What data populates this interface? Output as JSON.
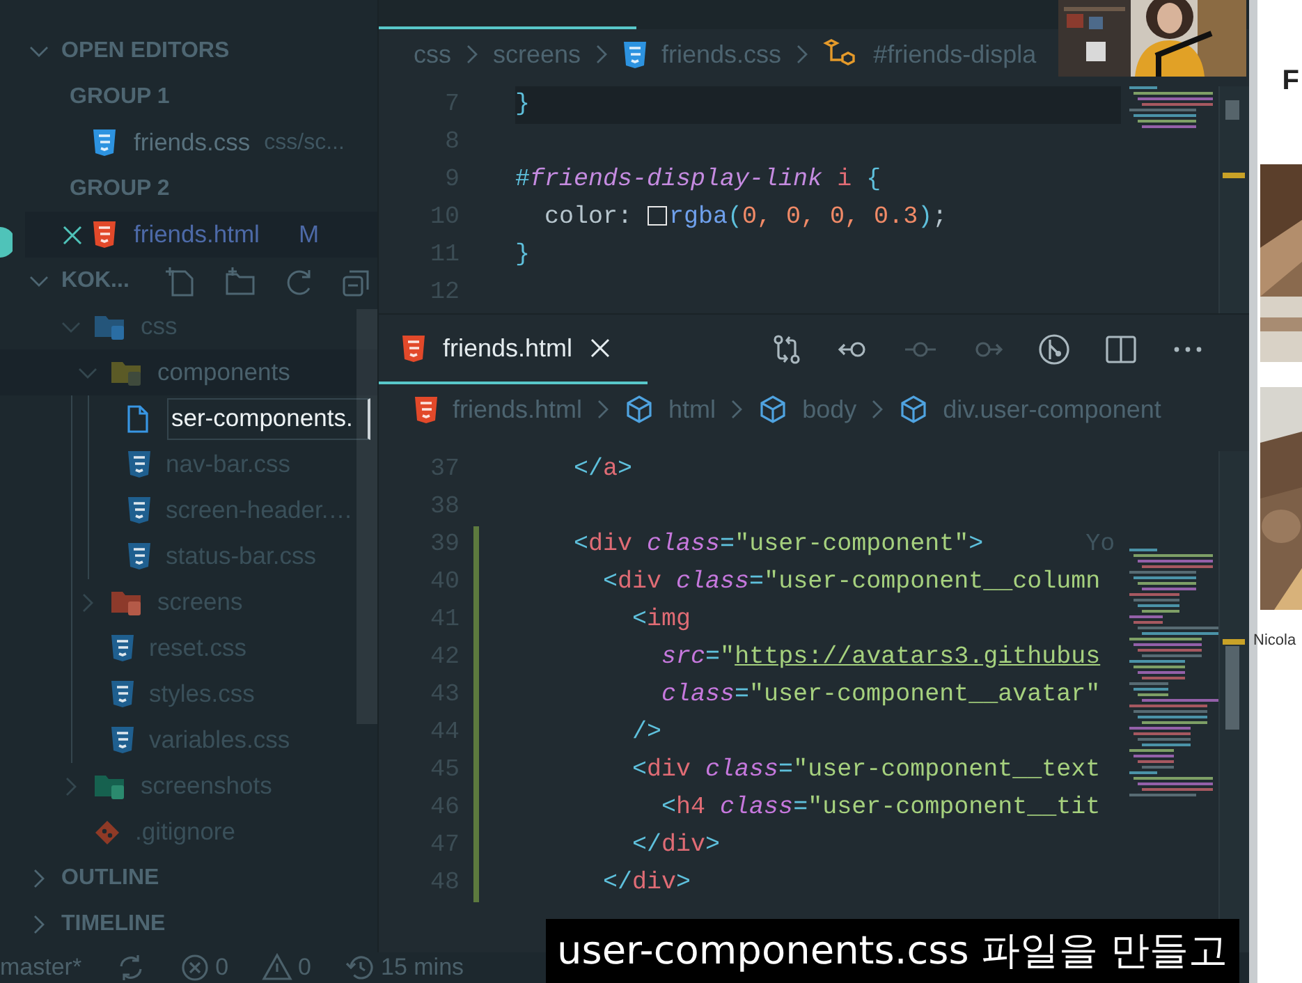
{
  "sidebar": {
    "open_editors": {
      "title": "OPEN EDITORS",
      "expanded": true,
      "groups": [
        {
          "title": "GROUP 1",
          "files": [
            {
              "name": "friends.css",
              "kind": "css",
              "path": "css/sc...",
              "selected": false
            }
          ]
        },
        {
          "title": "GROUP 2",
          "files": [
            {
              "name": "friends.html",
              "kind": "html",
              "badge": "M",
              "selected": true
            }
          ]
        }
      ]
    },
    "folder": {
      "title": "KOK...",
      "expanded": true,
      "actions": [
        {
          "kind": "new-file"
        },
        {
          "kind": "new-folder"
        },
        {
          "kind": "refresh"
        },
        {
          "kind": "collapse"
        }
      ],
      "tree": [
        {
          "name": "css",
          "kind": "folder-css",
          "expanded": true,
          "selected": false,
          "children": [
            {
              "name": "components",
              "kind": "folder-components",
              "expanded": true,
              "selected": true,
              "children": [
                {
                  "kind": "rename",
                  "value": "ser-components."
                },
                {
                  "name": "nav-bar.css",
                  "kind": "css",
                  "selected": false
                },
                {
                  "name": "screen-header.…",
                  "kind": "css",
                  "selected": false
                },
                {
                  "name": "status-bar.css",
                  "kind": "css",
                  "selected": false
                }
              ]
            },
            {
              "name": "screens",
              "kind": "folder-screens",
              "expanded": false,
              "selected": false
            },
            {
              "name": "reset.css",
              "kind": "css",
              "selected": false
            },
            {
              "name": "styles.css",
              "kind": "css",
              "selected": false
            },
            {
              "name": "variables.css",
              "kind": "css",
              "selected": false
            }
          ]
        },
        {
          "name": "screenshots",
          "kind": "folder-images",
          "expanded": false,
          "selected": false
        },
        {
          "name": ".gitignore",
          "kind": "git",
          "selected": false
        }
      ]
    },
    "sections": [
      {
        "title": "OUTLINE",
        "expanded": false
      },
      {
        "title": "TIMELINE",
        "expanded": false
      }
    ]
  },
  "editors": [
    {
      "tab": {
        "selected": true
      },
      "breadcrumb": [
        {
          "text": "css",
          "kind": "plain"
        },
        {
          "text": "screens",
          "kind": "plain"
        },
        {
          "text": "friends.css",
          "kind": "css"
        },
        {
          "text": "#friends-displa",
          "kind": "symbol"
        }
      ],
      "lines": [
        {
          "number": "7",
          "current": true,
          "tokens": [
            {
              "text": "}",
              "kind": "p"
            }
          ]
        },
        {
          "number": "8",
          "current": false
        },
        {
          "number": "9",
          "current": false,
          "tokens": [
            {
              "text": "#",
              "kind": "p"
            },
            {
              "text": "friends-display-link",
              "kind": "sel"
            },
            {
              "text": " i",
              "kind": "tag"
            },
            {
              "text": " {",
              "kind": "p"
            }
          ]
        },
        {
          "number": "10",
          "current": false,
          "tokens": [
            {
              "text": "  color: ",
              "kind": "prop"
            },
            {
              "kind": "swatch"
            },
            {
              "text": "rgba",
              "kind": "fn"
            },
            {
              "text": "(",
              "kind": "p"
            },
            {
              "text": "0, 0, 0, 0.3",
              "kind": "num"
            },
            {
              "text": ")",
              "kind": "p"
            },
            {
              "text": ";",
              "kind": "prop"
            }
          ]
        },
        {
          "number": "11",
          "current": false,
          "tokens": [
            {
              "text": "}",
              "kind": "p"
            }
          ]
        },
        {
          "number": "12",
          "current": false
        }
      ]
    },
    {
      "tab": {
        "label": "friends.html",
        "kind": "html",
        "selected": true
      },
      "toolbar": [
        {
          "kind": "compare",
          "disabled": false
        },
        {
          "kind": "back",
          "disabled": false
        },
        {
          "kind": "commit",
          "disabled": true
        },
        {
          "kind": "forward",
          "disabled": true
        },
        {
          "kind": "graph",
          "disabled": false
        },
        {
          "kind": "split",
          "disabled": false
        },
        {
          "kind": "more",
          "disabled": false
        }
      ],
      "breadcrumb": [
        {
          "text": "friends.html",
          "kind": "html"
        },
        {
          "text": "html",
          "kind": "cube"
        },
        {
          "text": "body",
          "kind": "cube"
        },
        {
          "text": "div.user-component",
          "kind": "cube"
        }
      ],
      "lines": [
        {
          "number": "37",
          "changed": false,
          "tokens": [
            {
              "text": "    </",
              "kind": "p"
            },
            {
              "text": "a",
              "kind": "tag"
            },
            {
              "text": ">",
              "kind": "p"
            }
          ]
        },
        {
          "number": "38",
          "changed": false
        },
        {
          "number": "39",
          "changed": true,
          "tokens": [
            {
              "text": "    <",
              "kind": "p"
            },
            {
              "text": "div",
              "kind": "tag"
            },
            {
              "text": " class",
              "kind": "attr"
            },
            {
              "text": "=",
              "kind": "p"
            },
            {
              "text": "\"user-component\"",
              "kind": "str"
            },
            {
              "text": ">",
              "kind": "p"
            },
            {
              "text": "Yo",
              "kind": "blame"
            }
          ]
        },
        {
          "number": "40",
          "changed": true,
          "tokens": [
            {
              "text": "      <",
              "kind": "p"
            },
            {
              "text": "div",
              "kind": "tag"
            },
            {
              "text": " class",
              "kind": "attr"
            },
            {
              "text": "=",
              "kind": "p"
            },
            {
              "text": "\"user-component__column",
              "kind": "str"
            }
          ]
        },
        {
          "number": "41",
          "changed": true,
          "tokens": [
            {
              "text": "        <",
              "kind": "p"
            },
            {
              "text": "img",
              "kind": "tag"
            }
          ]
        },
        {
          "number": "42",
          "changed": true,
          "tokens": [
            {
              "text": "          src",
              "kind": "attr"
            },
            {
              "text": "=",
              "kind": "p"
            },
            {
              "text": "\"",
              "kind": "str"
            },
            {
              "text": "https://avatars3.githubus",
              "kind": "url"
            }
          ]
        },
        {
          "number": "43",
          "changed": true,
          "tokens": [
            {
              "text": "          class",
              "kind": "attr"
            },
            {
              "text": "=",
              "kind": "p"
            },
            {
              "text": "\"user-component__avatar\"",
              "kind": "str"
            }
          ]
        },
        {
          "number": "44",
          "changed": true,
          "tokens": [
            {
              "text": "        />",
              "kind": "p"
            }
          ]
        },
        {
          "number": "45",
          "changed": true,
          "tokens": [
            {
              "text": "        <",
              "kind": "p"
            },
            {
              "text": "div",
              "kind": "tag"
            },
            {
              "text": " class",
              "kind": "attr"
            },
            {
              "text": "=",
              "kind": "p"
            },
            {
              "text": "\"user-component__text",
              "kind": "str"
            }
          ]
        },
        {
          "number": "46",
          "changed": true,
          "tokens": [
            {
              "text": "          <",
              "kind": "p"
            },
            {
              "text": "h4",
              "kind": "tag"
            },
            {
              "text": " class",
              "kind": "attr"
            },
            {
              "text": "=",
              "kind": "p"
            },
            {
              "text": "\"user-component__tit",
              "kind": "str"
            }
          ]
        },
        {
          "number": "47",
          "changed": true,
          "tokens": [
            {
              "text": "        </",
              "kind": "p"
            },
            {
              "text": "div",
              "kind": "tag"
            },
            {
              "text": ">",
              "kind": "p"
            }
          ]
        },
        {
          "number": "48",
          "changed": true,
          "tokens": [
            {
              "text": "      </",
              "kind": "p"
            },
            {
              "text": "div",
              "kind": "tag"
            },
            {
              "text": ">",
              "kind": "p"
            }
          ]
        }
      ]
    }
  ],
  "status_bar": [
    {
      "kind": "branch",
      "text": "master*"
    },
    {
      "kind": "sync"
    },
    {
      "kind": "errors",
      "text": "0"
    },
    {
      "kind": "warnings",
      "text": "0"
    },
    {
      "kind": "history",
      "text": "15 mins"
    }
  ],
  "preview": {
    "heading": "F",
    "caption": "Nicola"
  },
  "subtitle": "user-components.css 파일을 만들고"
}
